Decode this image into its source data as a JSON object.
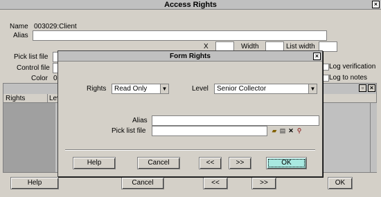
{
  "window": {
    "title": "Access Rights",
    "close": "×"
  },
  "main": {
    "name_label": "Name",
    "name_value": "003029:Client",
    "alias_label": "Alias",
    "x_label": "X",
    "width_label": "Width",
    "list_width_label": "List width",
    "pick_list_label": "Pick list file",
    "control_file_label": "Control file",
    "color_label": "Color",
    "color_value_partial": "0",
    "log_verification_label": "Log verification",
    "log_to_notes_label": "Log to notes",
    "grid_columns": [
      "Rights",
      "Lev"
    ],
    "buttons": {
      "help": "Help",
      "cancel": "Cancel",
      "prev": "<<",
      "next": ">>",
      "ok": "OK"
    }
  },
  "dialog": {
    "title": "Form Rights",
    "close": "×",
    "rights_label": "Rights",
    "rights_value": "Read Only",
    "level_label": "Level",
    "level_value": "Senior Collector",
    "alias_label": "Alias",
    "alias_value": "",
    "pick_list_label": "Pick list file",
    "pick_list_value": "",
    "buttons": {
      "help": "Help",
      "cancel": "Cancel",
      "prev": "<<",
      "next": ">>",
      "ok": "OK"
    }
  },
  "icons": {
    "open_folder": "open-folder-icon",
    "printer": "printer-icon",
    "delete": "delete-icon",
    "search": "search-icon"
  }
}
